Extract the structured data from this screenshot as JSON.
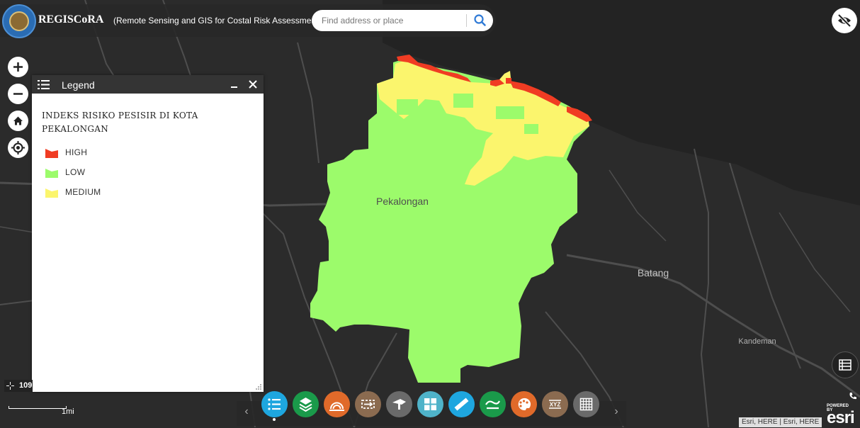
{
  "app": {
    "title": "REGISCoRA",
    "subtitle": "(Remote Sensing and GIS for Costal Risk Assessment)"
  },
  "search": {
    "placeholder": "Find address or place",
    "button_icon": "search-icon"
  },
  "visibility_toggle_icon": "eye-off-icon",
  "map": {
    "place_labels": [
      "Pekalongan",
      "Batang",
      "Kandeman"
    ],
    "base_color": "#2b2b2b",
    "sea_color": "#232323",
    "road_color": "#4e4e4e"
  },
  "map_controls": [
    {
      "name": "zoom-in",
      "glyph": "+"
    },
    {
      "name": "zoom-out",
      "glyph": "−"
    },
    {
      "name": "home",
      "glyph": "home-icon"
    },
    {
      "name": "my-location",
      "glyph": "locate-icon"
    }
  ],
  "legend": {
    "title": "Legend",
    "heading": "INDEKS RISIKO PESISIR DI KOTA PEKALONGAN",
    "items": [
      {
        "label": "HIGH",
        "color": "#f03c23"
      },
      {
        "label": "LOW",
        "color": "#9cfb6b"
      },
      {
        "label": "MEDIUM",
        "color": "#fbf56d"
      }
    ]
  },
  "coordinate_readout": "109",
  "scale_label": "1mi",
  "toolbar": [
    {
      "name": "legend",
      "color": "#1ea6df"
    },
    {
      "name": "layer-list",
      "color": "#1a9a4a"
    },
    {
      "name": "basemap-gallery",
      "color": "#e06a2a"
    },
    {
      "name": "swipe",
      "color": "#8b6b50"
    },
    {
      "name": "query",
      "color": "#6a6a6a"
    },
    {
      "name": "dashboard",
      "color": "#4fb3c9"
    },
    {
      "name": "measurement",
      "color": "#1ea6df"
    },
    {
      "name": "analysis",
      "color": "#1a9a4a"
    },
    {
      "name": "print",
      "color": "#e06a2a"
    },
    {
      "name": "coordinate-xyz",
      "color": "#8b6b50",
      "label": "XYZ"
    },
    {
      "name": "grid-overlay",
      "color": "#6a6a6a"
    }
  ],
  "attribution": "Esri, HERE | Esri, HERE",
  "esri_logo": {
    "powered": "POWERED BY",
    "mark": "esri"
  }
}
